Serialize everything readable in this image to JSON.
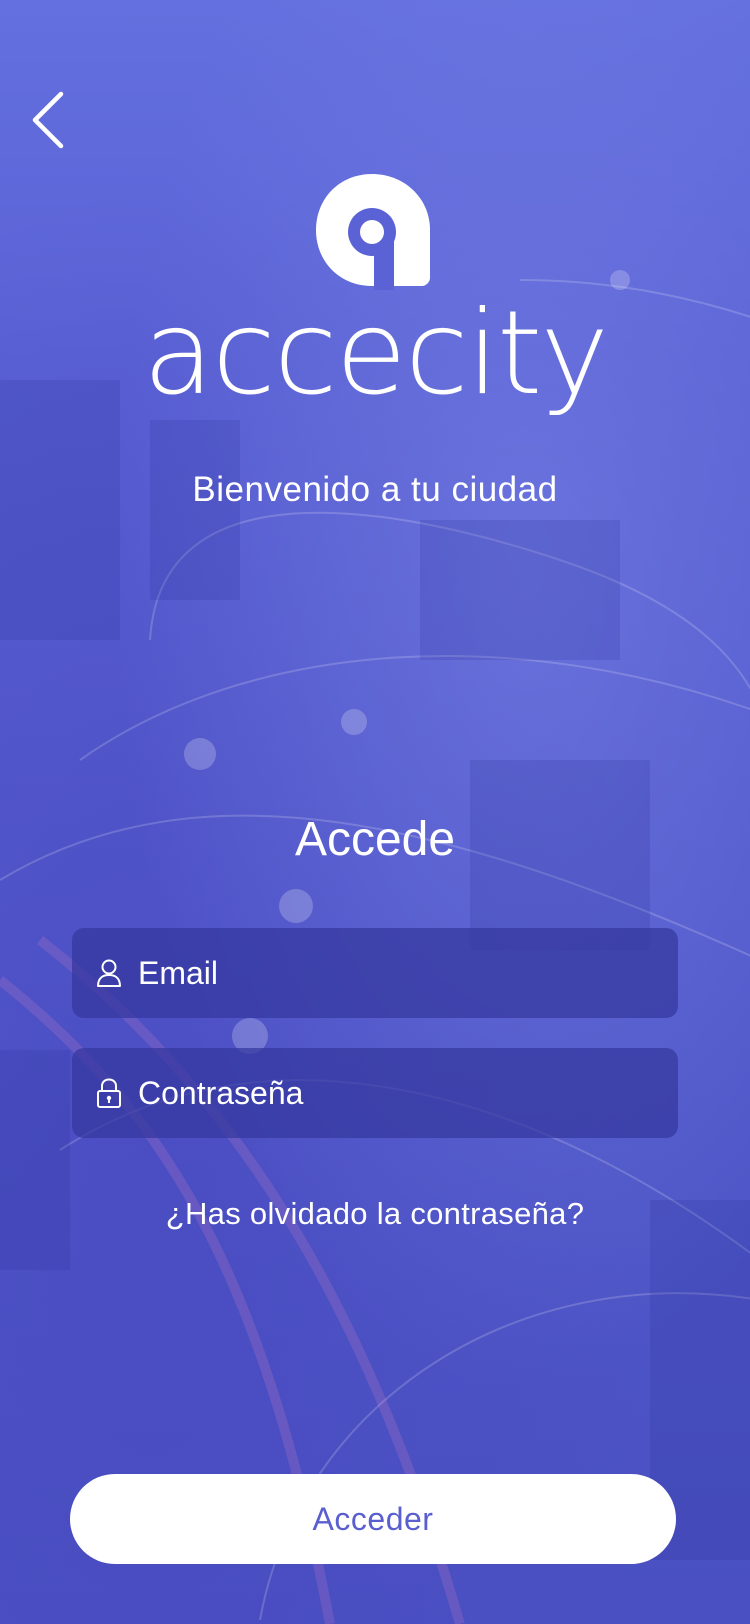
{
  "brand": {
    "name": "accecity",
    "tagline": "Bienvenido a tu ciudad"
  },
  "login": {
    "title": "Accede",
    "email_placeholder": "Email",
    "password_placeholder": "Contraseña",
    "forgot_link": "¿Has olvidado la contraseña?",
    "submit_label": "Acceder"
  },
  "icons": {
    "back": "chevron-left-icon",
    "email": "user-icon",
    "password": "lock-icon"
  },
  "colors": {
    "background": "#5b62d6",
    "field_background": "#34389e",
    "button_background": "#ffffff",
    "button_text": "#5a5fd0",
    "text": "#ffffff"
  }
}
